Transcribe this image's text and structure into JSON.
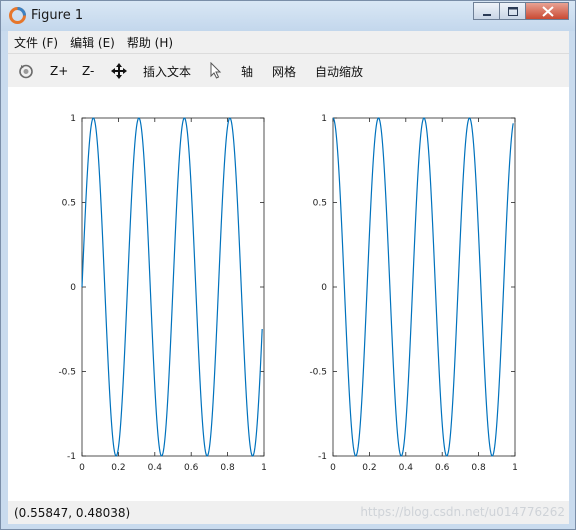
{
  "window": {
    "title": "Figure 1"
  },
  "menu": [
    {
      "label": "文件 (F)"
    },
    {
      "label": "编辑 (E)"
    },
    {
      "label": "帮助 (H)"
    }
  ],
  "toolbar": {
    "zoom_in": "Z+",
    "zoom_out": "Z-",
    "insert_text": "插入文本",
    "axis": "轴",
    "grid": "网格",
    "autoscale": "自动缩放"
  },
  "status": {
    "coords": "(0.55847, 0.48038)"
  },
  "watermark": "https://blog.csdn.net/u014776262",
  "colors": {
    "line": "#0072bd",
    "axes": "#262626"
  },
  "chart_data": [
    {
      "type": "line",
      "title": "",
      "xlabel": "",
      "ylabel": "",
      "xlim": [
        0,
        1
      ],
      "ylim": [
        -1,
        1
      ],
      "x_ticks": [
        "0",
        "0.2",
        "0.4",
        "0.6",
        "0.8",
        "1"
      ],
      "y_ticks": [
        "1",
        "0.5",
        "0",
        "-0.5",
        "-1"
      ],
      "function": "y = sin(2*pi*4*x)",
      "x_range": [
        0,
        0.99
      ]
    },
    {
      "type": "line",
      "title": "",
      "xlabel": "",
      "ylabel": "",
      "xlim": [
        0,
        1
      ],
      "ylim": [
        -1,
        1
      ],
      "x_ticks": [
        "0",
        "0.2",
        "0.4",
        "0.6",
        "0.8",
        "1"
      ],
      "y_ticks": [
        "1",
        "0.5",
        "0",
        "-0.5",
        "-1"
      ],
      "function": "y = cos(2*pi*4*x)",
      "x_range": [
        0,
        0.99
      ]
    }
  ]
}
